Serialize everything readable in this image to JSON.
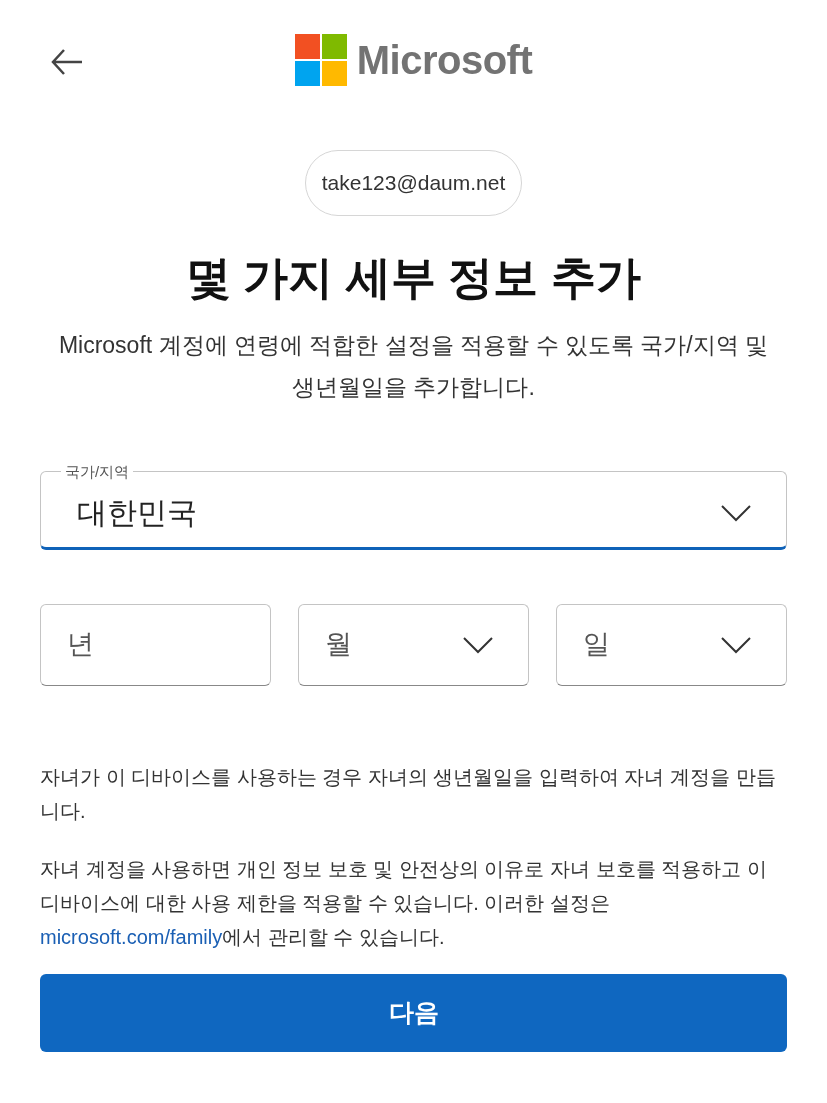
{
  "header": {
    "brand": "Microsoft"
  },
  "account": {
    "email": "take123@daum.net"
  },
  "title": "몇 가지 세부 정보 추가",
  "description": "Microsoft 계정에 연령에 적합한 설정을 적용할 수 있도록 국가/지역 및 생년월일을 추가합니다.",
  "country": {
    "label": "국가/지역",
    "value": "대한민국",
    "focused": true
  },
  "birthdate": [
    {
      "kind": "input",
      "placeholder": "년"
    },
    {
      "kind": "select",
      "placeholder": "월"
    },
    {
      "kind": "select",
      "placeholder": "일"
    }
  ],
  "notes": [
    {
      "text": "자녀가 이 디바이스를 사용하는 경우 자녀의 생년월일을 입력하여 자녀 계정을 만듭니다."
    },
    {
      "text": "자녀 계정을 사용하면 개인 정보 보호 및 안전상의 이유로 자녀 보호를 적용하고 이 디바이스에 대한 사용 제한을 적용할 수 있습니다. 이러한 설정은 ",
      "link": "microsoft.com/family",
      "after": "에서 관리할 수 있습니다."
    }
  ],
  "buttons": [
    {
      "label": "다음"
    }
  ]
}
